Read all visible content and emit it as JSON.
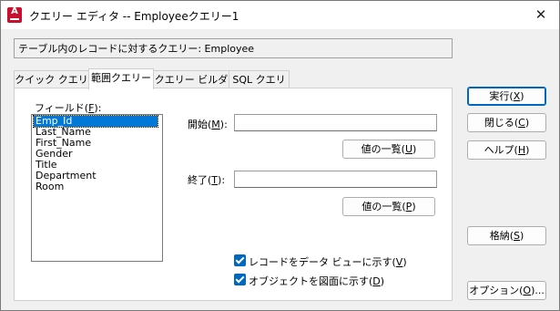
{
  "window": {
    "title": "クエリー エディタ -- Employeeクエリー1",
    "app_icon_letter": "A"
  },
  "info_bar": {
    "text": "テーブル内のレコードに対するクエリー:  Employee"
  },
  "tabs": [
    {
      "label": "クイック クエリー",
      "active": false
    },
    {
      "label": "範囲クエリー",
      "active": true
    },
    {
      "label": "クエリー ビルダー",
      "active": false
    },
    {
      "label": "SQL クエリー",
      "active": false
    }
  ],
  "fields": {
    "label_prefix": "フィールド(",
    "label_key": "F",
    "label_suffix": "):",
    "items": [
      "Emp_Id",
      "Last_Name",
      "First_Name",
      "Gender",
      "Title",
      "Department",
      "Room"
    ],
    "selected": "Emp_Id"
  },
  "start": {
    "label_prefix": "開始(",
    "label_key": "M",
    "label_suffix": "):",
    "value": "",
    "list_button_prefix": "値の一覧(",
    "list_button_key": "U",
    "list_button_suffix": ")"
  },
  "end": {
    "label_prefix": "終了(",
    "label_key": "T",
    "label_suffix": "):",
    "value": "",
    "list_button_prefix": "値の一覧(",
    "list_button_key": "P",
    "list_button_suffix": ")"
  },
  "options": {
    "show_in_data_view": {
      "prefix": "レコードをデータ ビューに示す(",
      "key": "V",
      "suffix": ")",
      "checked": true
    },
    "show_in_drawing": {
      "prefix": "オブジェクトを図面に示す(",
      "key": "D",
      "suffix": ")",
      "checked": true
    }
  },
  "buttons": {
    "execute": {
      "prefix": "実行(",
      "key": "X",
      "suffix": ")"
    },
    "close": {
      "prefix": "閉じる(",
      "key": "C",
      "suffix": ")"
    },
    "help": {
      "prefix": "ヘルプ(",
      "key": "H",
      "suffix": ")"
    },
    "store": {
      "prefix": "格納(",
      "key": "S",
      "suffix": ")"
    },
    "options": {
      "prefix": "オプション(",
      "key": "O",
      "suffix": ")..."
    }
  },
  "colors": {
    "accent": "#0067c0",
    "selection": "#0078d7",
    "app_icon": "#c8102e"
  }
}
